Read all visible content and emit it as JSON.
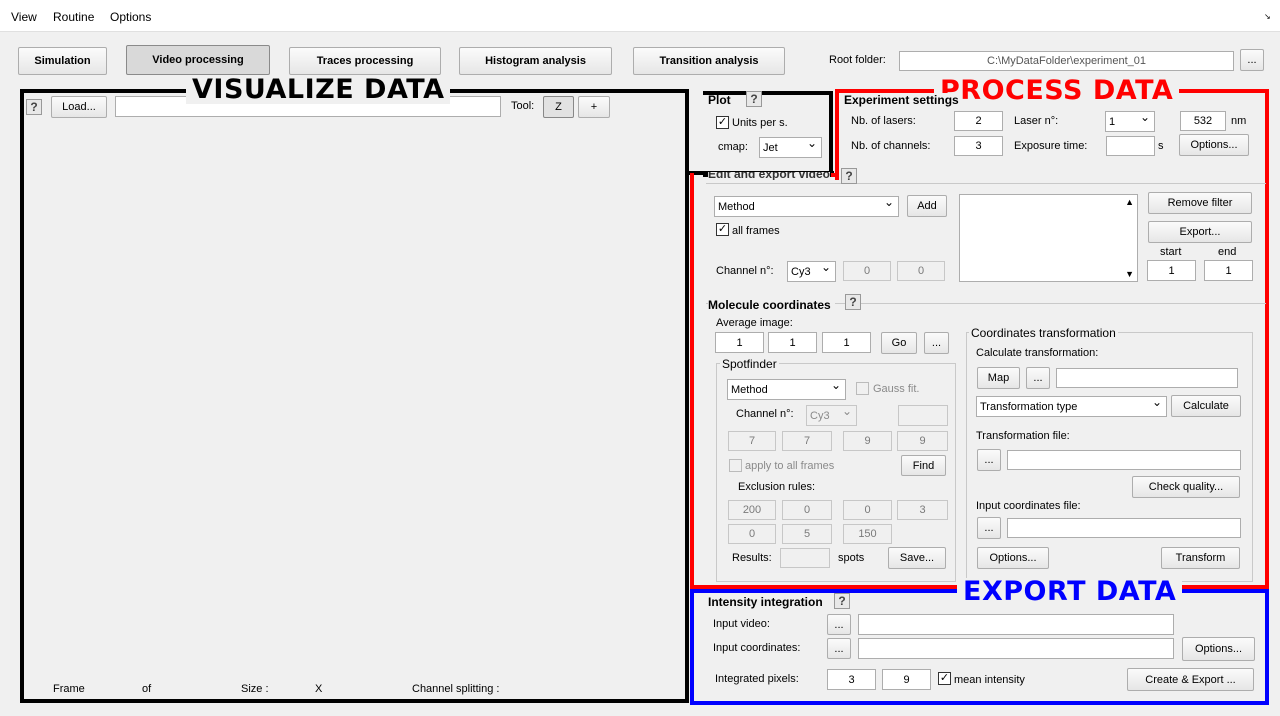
{
  "menu": [
    "View",
    "Routine",
    "Options"
  ],
  "menu_corner_icon": "small-arrow-icon",
  "tabs": [
    "Simulation",
    "Video processing",
    "Traces processing",
    "Histogram analysis",
    "Transition analysis"
  ],
  "root": {
    "label": "Root folder:",
    "path": "C:\\MyDataFolder\\experiment_01",
    "browse": "..."
  },
  "overlays": {
    "visualize": "VISUALIZE DATA",
    "process": "PROCESS DATA",
    "export": "EXPORT DATA",
    "colors": {
      "visualize": "#000000",
      "process": "#ff0000",
      "export": "#0000ff"
    }
  },
  "viewer": {
    "help": "?",
    "load": "Load...",
    "path": "",
    "tool_label": "Tool:",
    "tool_z": "Z",
    "tool_plus": "+",
    "frame": "Frame",
    "of": "of",
    "size": "Size :",
    "x": "X",
    "splitting": "Channel splitting :"
  },
  "plot": {
    "title": "Plot",
    "help": "?",
    "units_label": "Units per s.",
    "units_checked": "✓",
    "cmap_label": "cmap:",
    "cmap_value": "Jet"
  },
  "experiment": {
    "title": "Experiment settings",
    "help": "?",
    "lasers_label": "Nb. of lasers:",
    "lasers": "2",
    "laser_n_label": "Laser n°:",
    "laser_n": "1",
    "wavelength": "532",
    "nm": "nm",
    "channels_label": "Nb. of channels:",
    "channels": "3",
    "exposure_label": "Exposure time:",
    "exposure": "",
    "s": "s",
    "options": "Options..."
  },
  "edit": {
    "title": "Edit and export video",
    "help": "?",
    "method": "Method",
    "add": "Add",
    "all_frames": "all frames",
    "all_frames_checked": "✓",
    "channel_label": "Channel n°:",
    "channel": "Cy3",
    "val1": "0",
    "val2": "0",
    "remove": "Remove filter",
    "export": "Export...",
    "start_label": "start",
    "end_label": "end",
    "start": "1",
    "end": "1"
  },
  "coords": {
    "title": "Molecule coordinates",
    "help": "?",
    "avg_label": "Average image:",
    "avg1": "1",
    "avg2": "1",
    "avg3": "1",
    "go": "Go",
    "dots": "...",
    "spotfinder": {
      "title": "Spotfinder",
      "method": "Method",
      "gauss": "Gauss fit.",
      "channel_label": "Channel n°:",
      "channel": "Cy3",
      "p1": "7",
      "p2": "7",
      "p3": "9",
      "p4": "9",
      "apply": "apply to all frames",
      "find": "Find",
      "exclusion": "Exclusion rules:",
      "e1": "200",
      "e2": "0",
      "e3": "0",
      "e4": "3",
      "e5": "0",
      "e6": "5",
      "e7": "150",
      "results": "Results:",
      "spots": "spots",
      "save": "Save..."
    },
    "transform": {
      "title": "Coordinates transformation",
      "calc_label": "Calculate transformation:",
      "map": "Map",
      "dots": "...",
      "type": "Transformation type",
      "calculate": "Calculate",
      "file_label": "Transformation file:",
      "check": "Check quality...",
      "input_label": "Input coordinates file:",
      "options": "Options...",
      "transform": "Transform"
    }
  },
  "integration": {
    "title": "Intensity integration",
    "help": "?",
    "video_label": "Input video:",
    "coords_label": "Input coordinates:",
    "dots": "...",
    "options": "Options...",
    "pixels_label": "Integrated pixels:",
    "px1": "3",
    "px2": "9",
    "mean": "mean intensity",
    "mean_checked": "✓",
    "create": "Create & Export ..."
  }
}
